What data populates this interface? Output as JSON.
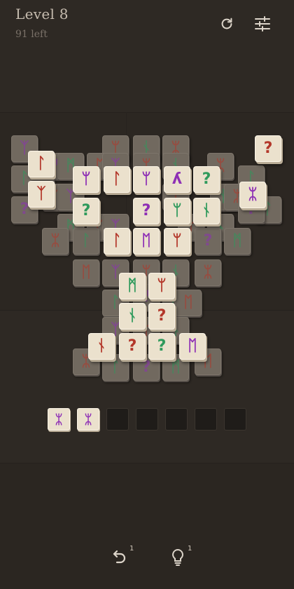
{
  "header": {
    "level": "Level 8",
    "remaining": "91 left"
  },
  "icons": {
    "restart": "restart-icon",
    "settings": "sliders-icon",
    "undo": "undo-icon",
    "hint": "lightbulb-icon"
  },
  "colors": {
    "purple": "#8e2fb5",
    "red": "#b3372a",
    "green": "#2f9a5c"
  },
  "glyphs": {
    "A": "ʎ",
    "B": "ϑ",
    "C": "ϒ",
    "D": "ᛘ",
    "E": "ᚻ",
    "F": "?",
    "G": "ᚾ",
    "H": "ᛖ",
    "I": "Ϟ"
  },
  "tray": {
    "slots_total": 7,
    "filled": [
      {
        "glyph": "ᛯ",
        "color": "purple"
      },
      {
        "glyph": "ᛯ",
        "color": "purple"
      }
    ]
  },
  "tools": {
    "undo_count": "1",
    "hint_count": "1"
  },
  "board": {
    "top_tiles": [
      {
        "g": "?",
        "c": "red"
      },
      {
        "g": "ᛚ",
        "c": "red"
      },
      {
        "g": "ᛘ",
        "c": "purple"
      },
      {
        "g": "ᛚ",
        "c": "red"
      },
      {
        "g": "ᛘ",
        "c": "purple"
      },
      {
        "g": "ʎ",
        "c": "purple"
      },
      {
        "g": "?",
        "c": "green"
      },
      {
        "g": "ᛯ",
        "c": "purple"
      },
      {
        "g": "ᛉ",
        "c": "red"
      },
      {
        "g": "?",
        "c": "green"
      },
      {
        "g": "?",
        "c": "purple"
      },
      {
        "g": "ᛘ",
        "c": "green"
      },
      {
        "g": "ᚾ",
        "c": "green"
      },
      {
        "g": "ᛚ",
        "c": "red"
      },
      {
        "g": "ᛖ",
        "c": "purple"
      },
      {
        "g": "ᛘ",
        "c": "red"
      },
      {
        "g": "ᛗ",
        "c": "green"
      },
      {
        "g": "ᛘ",
        "c": "red"
      },
      {
        "g": "ᚾ",
        "c": "green"
      },
      {
        "g": "?",
        "c": "red"
      },
      {
        "g": "ᚾ",
        "c": "red"
      },
      {
        "g": "?",
        "c": "red"
      },
      {
        "g": "?",
        "c": "green"
      },
      {
        "g": "ᛖ",
        "c": "purple"
      },
      {
        "g": "ᛗ",
        "c": "green"
      }
    ]
  }
}
